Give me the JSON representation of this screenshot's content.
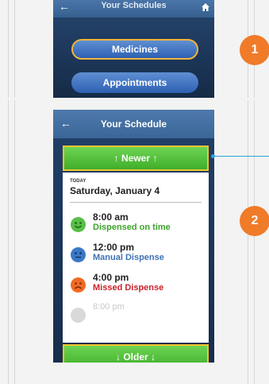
{
  "panel1": {
    "title": "Your Schedules",
    "back_icon": "←",
    "home_icon": "home-icon",
    "buttons": [
      {
        "label": "Medicines",
        "selected": true
      },
      {
        "label": "Appointments",
        "selected": false
      }
    ],
    "callout_number": "1"
  },
  "panel2": {
    "title": "Your Schedule",
    "back_icon": "←",
    "newer_label": "↑ Newer ↑",
    "older_label": "↓ Older ↓",
    "day_label": "TODAY",
    "date": "Saturday, January 4",
    "entries": [
      {
        "time": "8:00 am",
        "status": "Dispensed on time",
        "status_color": "#3da42a",
        "face_color": "#58bf48",
        "mood": "smile"
      },
      {
        "time": "12:00 pm",
        "status": "Manual Dispense",
        "status_color": "#3f72b6",
        "face_color": "#3b78c7",
        "mood": "neutral"
      },
      {
        "time": "4:00 pm",
        "status": "Missed Dispense",
        "status_color": "#c9222a",
        "face_color": "#f06a25",
        "mood": "frown"
      },
      {
        "time": "8:00 pm",
        "status": "",
        "status_color": "#c8c8c8",
        "face_color": "#d9d9d9",
        "mood": "none"
      }
    ],
    "callout_number": "2"
  },
  "colors": {
    "accent_orange": "#f07b29",
    "highlight_yellow": "#f0c530",
    "connector_blue": "#2aa4d8"
  }
}
